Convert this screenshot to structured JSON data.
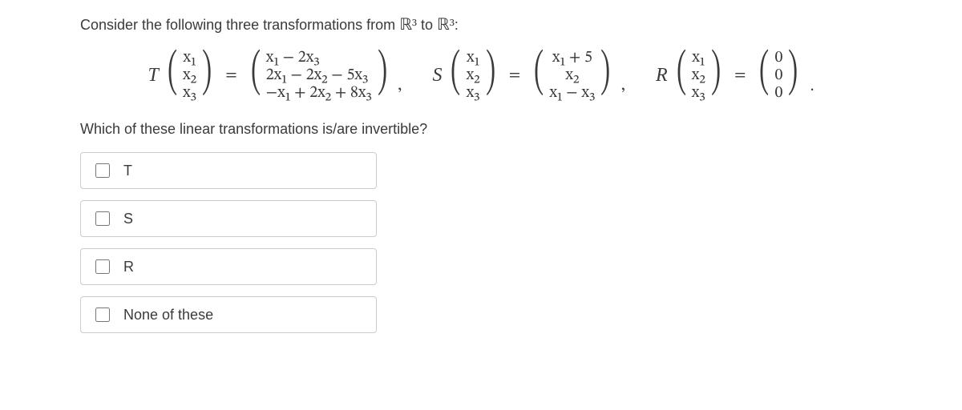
{
  "prompt_prefix": "Consider the following three transformations from ",
  "space_from": "ℝ³",
  "prompt_mid": " to ",
  "space_to": "ℝ³",
  "prompt_suffix": ":",
  "transforms": {
    "T": {
      "name": "T",
      "input": [
        "x₁",
        "x₂",
        "x₃"
      ],
      "output": [
        "x₁ − 2x₃",
        "2x₁ − 2x₂ − 5x₃",
        "−x₁ + 2x₂ + 8x₃"
      ]
    },
    "S": {
      "name": "S",
      "input": [
        "x₁",
        "x₂",
        "x₃"
      ],
      "output": [
        "x₁ + 5",
        "x₂",
        "x₁ − x₃"
      ]
    },
    "R": {
      "name": "R",
      "input": [
        "x₁",
        "x₂",
        "x₃"
      ],
      "output": [
        "0",
        "0",
        "0"
      ]
    }
  },
  "question": "Which of these linear transformations is/are invertible?",
  "options": {
    "T": "T",
    "S": "S",
    "R": "R",
    "none": "None of these"
  }
}
